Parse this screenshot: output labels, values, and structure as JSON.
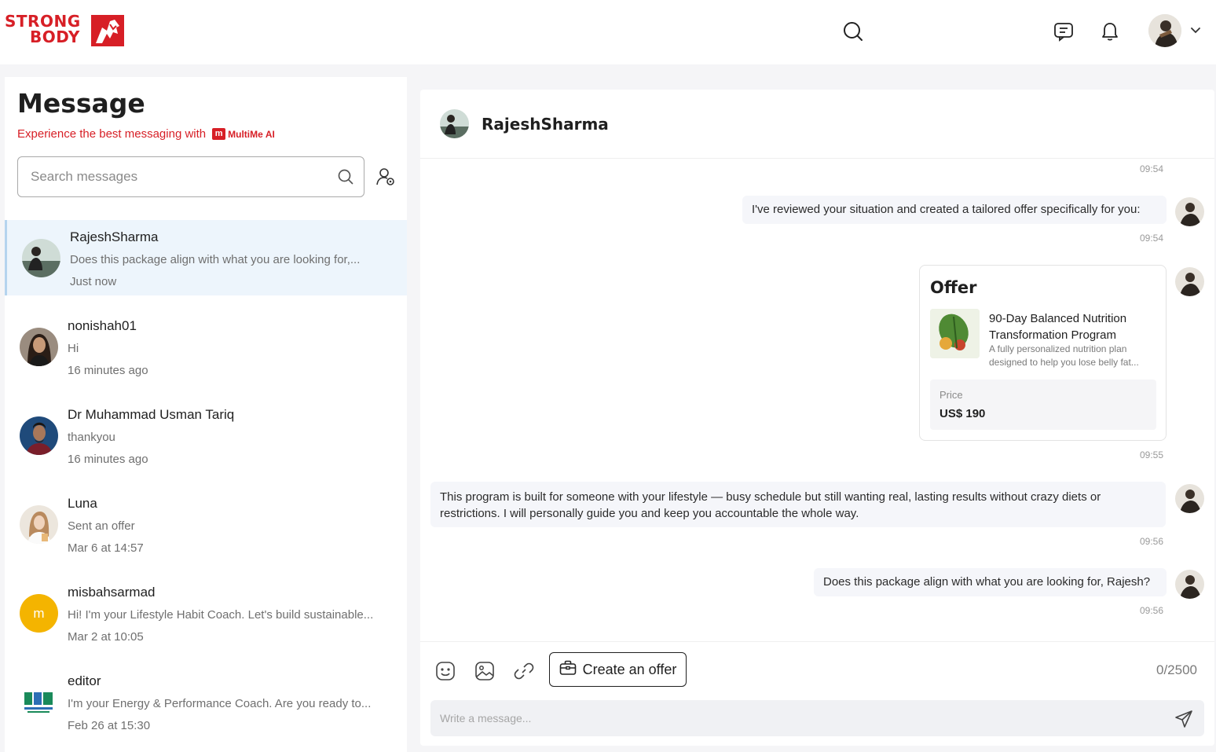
{
  "brand": {
    "line1": "STRONG",
    "line2": "BODY",
    "color": "#d71f26"
  },
  "header": {
    "icons": [
      "search-icon",
      "chat-icon",
      "bell-icon",
      "avatar",
      "chevron-down-icon"
    ]
  },
  "sidebar": {
    "title": "Message",
    "subtitle": "Experience the best messaging with",
    "badge_mark": "m",
    "badge_text": "MultiMe",
    "badge_ai": "AI",
    "search_placeholder": "Search messages",
    "conversations": [
      {
        "name": "RajeshSharma",
        "preview": "Does this package align with what you are looking for,...",
        "time": "Just now",
        "active": true
      },
      {
        "name": "nonishah01",
        "preview": "Hi",
        "time": "16 minutes ago",
        "active": false
      },
      {
        "name": "Dr Muhammad Usman Tariq",
        "preview": "thankyou",
        "time": "16 minutes ago",
        "active": false
      },
      {
        "name": "Luna",
        "preview": "Sent an offer",
        "time": "Mar 6 at 14:57",
        "active": false
      },
      {
        "name": "misbahsarmad",
        "preview": "Hi! I'm your Lifestyle Habit Coach. Let's build sustainable...",
        "time": "Mar 2 at 10:05",
        "active": false,
        "initial": "m"
      },
      {
        "name": "editor",
        "preview": "I'm your Energy & Performance Coach. Are you ready to...",
        "time": "Feb 26 at 15:30",
        "active": false
      }
    ]
  },
  "chat": {
    "contact_name": "RajeshSharma",
    "messages": [
      {
        "time_before": "09:54"
      },
      {
        "text": "I've reviewed your situation and created a tailored offer specifically for you:",
        "time": "09:54"
      },
      {
        "type": "offer",
        "heading": "Offer",
        "title": "90-Day Balanced Nutrition Transformation Program",
        "description": "A fully personalized nutrition plan designed to help you lose belly fat...",
        "price_label": "Price",
        "price": "US$ 190",
        "time": "09:55"
      },
      {
        "text": "This program is built for someone with your lifestyle — busy schedule but still wanting real, lasting results without crazy diets or restrictions. I will personally guide you and keep you accountable the whole way.",
        "time": "09:56"
      },
      {
        "text": "Does this package align with what you are looking for, Rajesh?",
        "time": "09:56"
      }
    ],
    "composer": {
      "create_offer_label": "Create an offer",
      "counter": "0/2500",
      "placeholder": "Write a message..."
    }
  }
}
